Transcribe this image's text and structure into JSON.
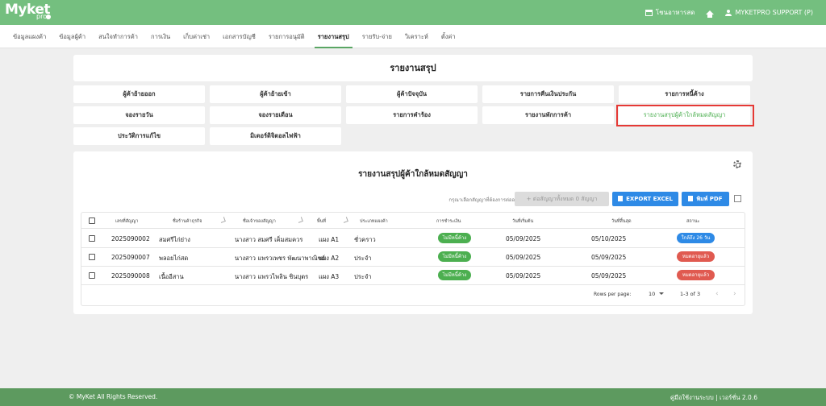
{
  "header": {
    "logo_text": "Myket",
    "logo_sub": "pro",
    "store_name": "โชนอาหารสด",
    "user_label": "MYKETPRO SUPPORT (P)"
  },
  "nav": [
    "ข้อมูลแผงค้า",
    "ข้อมูลผู้ค้า",
    "สนใจทำการค้า",
    "การเงิน",
    "เก็บค่าเช่า",
    "เอกสารบัญชี",
    "รายการอนุมัติ",
    "รายงานสรุป",
    "รายรับ-จ่าย",
    "วิเคราะห์",
    "ตั้งค่า"
  ],
  "page_title": "รายงานสรุป",
  "menu": [
    "ผู้ค้าย้ายออก",
    "ผู้ค้าย้ายเข้า",
    "ผู้ค้าปัจจุบัน",
    "รายการคืนเงินประกัน",
    "รายการหนี้ค้าง",
    "จองรายวัน",
    "จองรายเดือน",
    "รายการคำร้อง",
    "รายงานพักการค้า",
    "รายงานสรุปผู้ค้าใกล้หมดสัญญา",
    "ประวัติการแก้ไข",
    "มิเตอร์ดิจิตอลไฟฟ้า"
  ],
  "report_title": "รายงานสรุปผู้ค้าใกล้หมดสัญญา",
  "toolbar": {
    "hint": "กรุณาเลือกสัญญาที่ต้องการต่ออายุ",
    "renew_label": "+ ต่อสัญญาทั้งหมด 0 สัญญา",
    "excel_label": "EXPORT EXCEL",
    "pdf_label": "พิมพ์ PDF"
  },
  "table": {
    "columns": [
      "เลขที่สัญญา",
      "ชื่อร้านค้าธุรกิจ",
      "ชื่อเจ้าของสัญญา",
      "พื้นที่",
      "ประเภทแผงค้า",
      "การชำระเงิน",
      "วันที่เริ่มต้น",
      "วันที่สิ้นสุด",
      "สถานะ"
    ],
    "rows": [
      {
        "contract": "2025090002",
        "shop": "สมศรีไก่ย่าง",
        "owner": "นางสาว สมศรี เค็มสมควร",
        "area": "แผง A1",
        "type": "ชั่วคราว",
        "payment": "ไม่มีหนี้ค้าง",
        "start": "05/09/2025",
        "end": "05/10/2025",
        "status": "ใกล้ถึง 26 วัน",
        "status_color": "#2e8ae6"
      },
      {
        "contract": "2025090007",
        "shop": "พลอยไก่สด",
        "owner": "นางสาว แพรวเพชร พัฒนาพาณิชย์",
        "area": "แผง A2",
        "type": "ประจำ",
        "payment": "ไม่มีหนี้ค้าง",
        "start": "05/09/2025",
        "end": "05/09/2025",
        "status": "หมดอายุแล้ว",
        "status_color": "#e05a50"
      },
      {
        "contract": "2025090008",
        "shop": "เนื้ออีสาน",
        "owner": "นางสาว แพรวไพลิน ชินบุตร",
        "area": "แผง A3",
        "type": "ประจำ",
        "payment": "ไม่มีหนี้ค้าง",
        "start": "05/09/2025",
        "end": "05/09/2025",
        "status": "หมดอายุแล้ว",
        "status_color": "#e05a50"
      }
    ]
  },
  "pager": {
    "rows_label": "Rows per page:",
    "rows_value": "10",
    "range": "1-3 of 3",
    "prev": "‹",
    "next": "›"
  },
  "footer": {
    "copyright": "© MyKet All Rights Reserved.",
    "version": "คู่มือใช้งานระบบ | เวอร์ชั่น 2.0.6"
  },
  "colors": {
    "primary": "#74bf7f",
    "accent_blue": "#2e8ae6",
    "danger": "#e05a50",
    "highlight_box": "#e53935"
  }
}
